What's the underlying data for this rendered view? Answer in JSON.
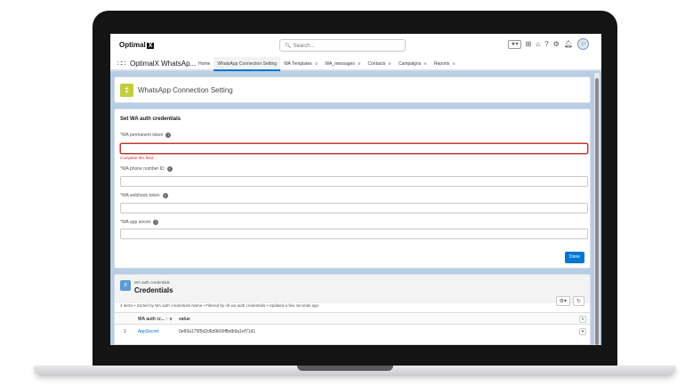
{
  "header": {
    "logo_text": "Optimal",
    "logo_badge": "X",
    "search_placeholder": "Search...",
    "favorite_label": "★▾"
  },
  "nav": {
    "app_name": "OptimalX WhatsAp...",
    "items": [
      {
        "label": "Home",
        "has_menu": false
      },
      {
        "label": "WhatsApp Connection Setting",
        "has_menu": false,
        "active": true
      },
      {
        "label": "WA Templates",
        "has_menu": true
      },
      {
        "label": "WA_messages",
        "has_menu": true
      },
      {
        "label": "Contacts",
        "has_menu": true
      },
      {
        "label": "Campaigns",
        "has_menu": true
      },
      {
        "label": "Reports",
        "has_menu": true
      }
    ]
  },
  "page_header": {
    "title": "WhatsApp Connection Setting"
  },
  "form": {
    "title": "Set WA auth credentials",
    "fields": [
      {
        "label": "WA permanent token",
        "value": "",
        "error": true
      },
      {
        "label": "WA phone number ID",
        "value": ""
      },
      {
        "label": "WA webhook token",
        "value": ""
      },
      {
        "label": "WA app secret",
        "value": ""
      }
    ],
    "error_message": "Complete this field.",
    "done_label": "Done"
  },
  "related_list": {
    "subtitle": "WA auth credentials",
    "title": "Credentials",
    "meta": "4 items • Sorted by WA auth credentials Name • Filtered by All wa auth credentials • Updated a few seconds ago",
    "columns": [
      "WA auth cr... ↑ ∨",
      "value"
    ],
    "rows": [
      {
        "num": "1",
        "name": "AppSecret",
        "value": "0e89a175f5d2d6d9b00ffbdb9a1ef71d1"
      }
    ]
  },
  "colors": {
    "brand_blue": "#0176d3",
    "error_red": "#c23934",
    "page_icon": "#c2ce3a",
    "related_icon": "#5a9bd5",
    "background": "#b7cde3"
  }
}
